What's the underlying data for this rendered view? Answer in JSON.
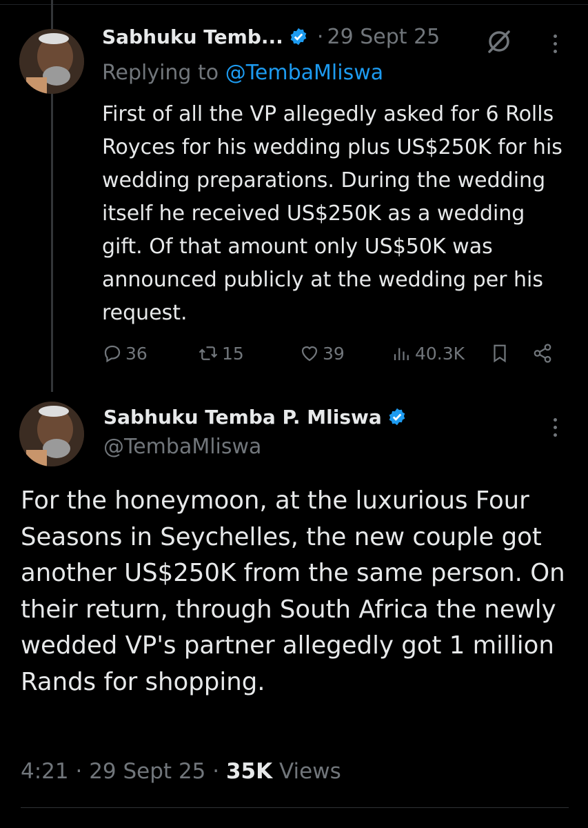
{
  "reply": {
    "display_name": "Sabhuku Temb...",
    "separator": "·",
    "time": "29 Sept 25",
    "replying_prefix": "Replying to",
    "replying_handle": "@TembaMliswa",
    "text": "First of all the VP allegedly asked for 6 Rolls Royces for his wedding plus US$250K for his wedding preparations. During the wedding itself he received US$250K as a wedding gift. Of that amount only US$50K was announced publicly at the wedding per his request.",
    "replies": "36",
    "reposts": "15",
    "likes": "39",
    "views": "40.3K"
  },
  "main": {
    "display_name": "Sabhuku Temba P. Mliswa",
    "handle": "@TembaMliswa",
    "text": "For the honeymoon, at the luxurious Four Seasons in Seychelles, the new couple got another US$250K from the same person. On their return, through South Africa the newly wedded VP's partner allegedly got 1 million Rands for shopping.",
    "time": "4:21",
    "date": "29 Sept 25",
    "sep": "·",
    "views_count": "35K",
    "views_label": "Views"
  },
  "colors": {
    "background": "#000000",
    "text": "#e7e9ea",
    "secondary": "#71767b",
    "accent": "#1d9bf0"
  },
  "icons": [
    "verified-badge-icon",
    "grok-icon",
    "more-icon",
    "reply-icon",
    "repost-icon",
    "like-icon",
    "views-icon",
    "bookmark-icon",
    "share-icon"
  ]
}
